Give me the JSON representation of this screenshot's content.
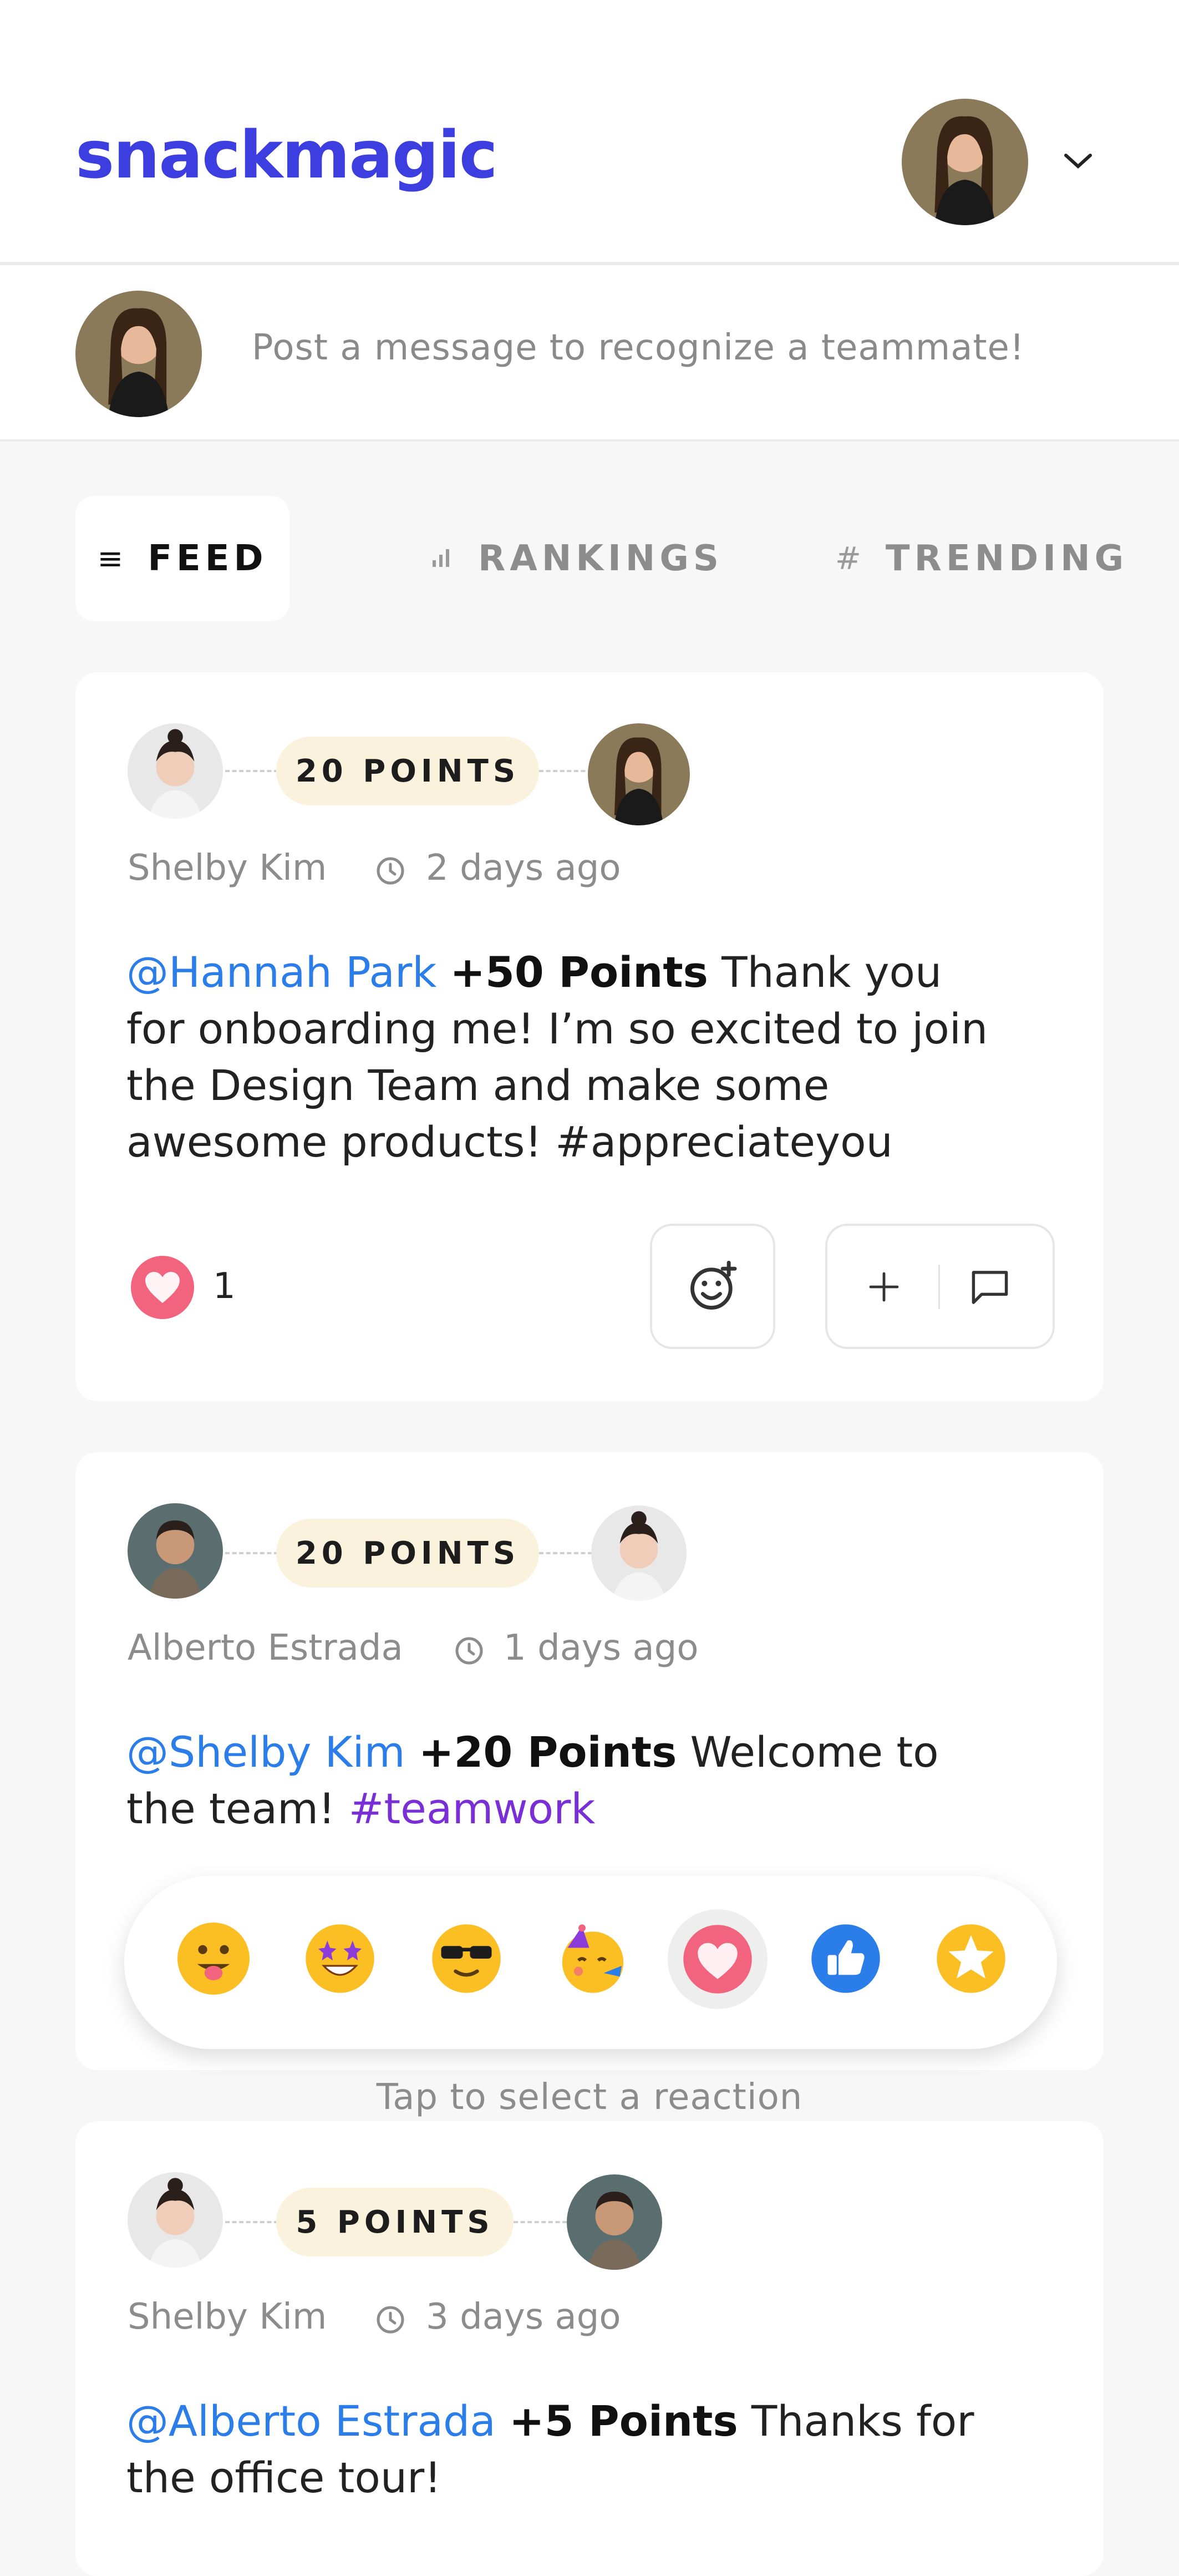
{
  "header": {
    "logo_text": "snackmagic",
    "dropdown_icon": "chevron-down-icon"
  },
  "composer": {
    "placeholder": "Post a message to recognize a teammate!"
  },
  "tabs": [
    {
      "label": "FEED",
      "icon": "list-icon",
      "active": true
    },
    {
      "label": "RANKINGS",
      "icon": "bar-chart-icon",
      "active": false
    },
    {
      "label": "TRENDING",
      "icon": "hashtag-icon",
      "active": false
    }
  ],
  "posts": [
    {
      "points_label": "20 POINTS",
      "author": "Shelby Kim",
      "time": "2 days ago",
      "mention": "@Hannah Park",
      "points_text": "+50 Points",
      "message": " Thank you for onboarding me! I’m so excited to join the Design Team and make some awesome products! #appreciateyou",
      "like_count": "1"
    },
    {
      "points_label": "20 POINTS",
      "author": "Alberto Estrada",
      "time": "1 days ago",
      "mention": "@Shelby Kim",
      "points_text": "+20 Points",
      "message": " Welcome to the team! ",
      "hashtag": "#teamwork"
    },
    {
      "points_label": "5 POINTS",
      "author": "Shelby Kim",
      "time": "3 days ago",
      "mention": "@Alberto Estrada",
      "points_text": "+5 Points",
      "message": " Thanks for the office tour!"
    }
  ],
  "reactions": {
    "hint": "Tap to select a reaction",
    "items": [
      "😛",
      "🤩",
      "😎",
      "🥳",
      "❤",
      "👍",
      "⭐"
    ],
    "selected_index": 4
  },
  "colors": {
    "brand": "#3c3ee0",
    "mention": "#2b7de9",
    "hashtag": "#7a2fd6",
    "points_pill": "#fbf2dd",
    "heart": "#f2647e"
  }
}
